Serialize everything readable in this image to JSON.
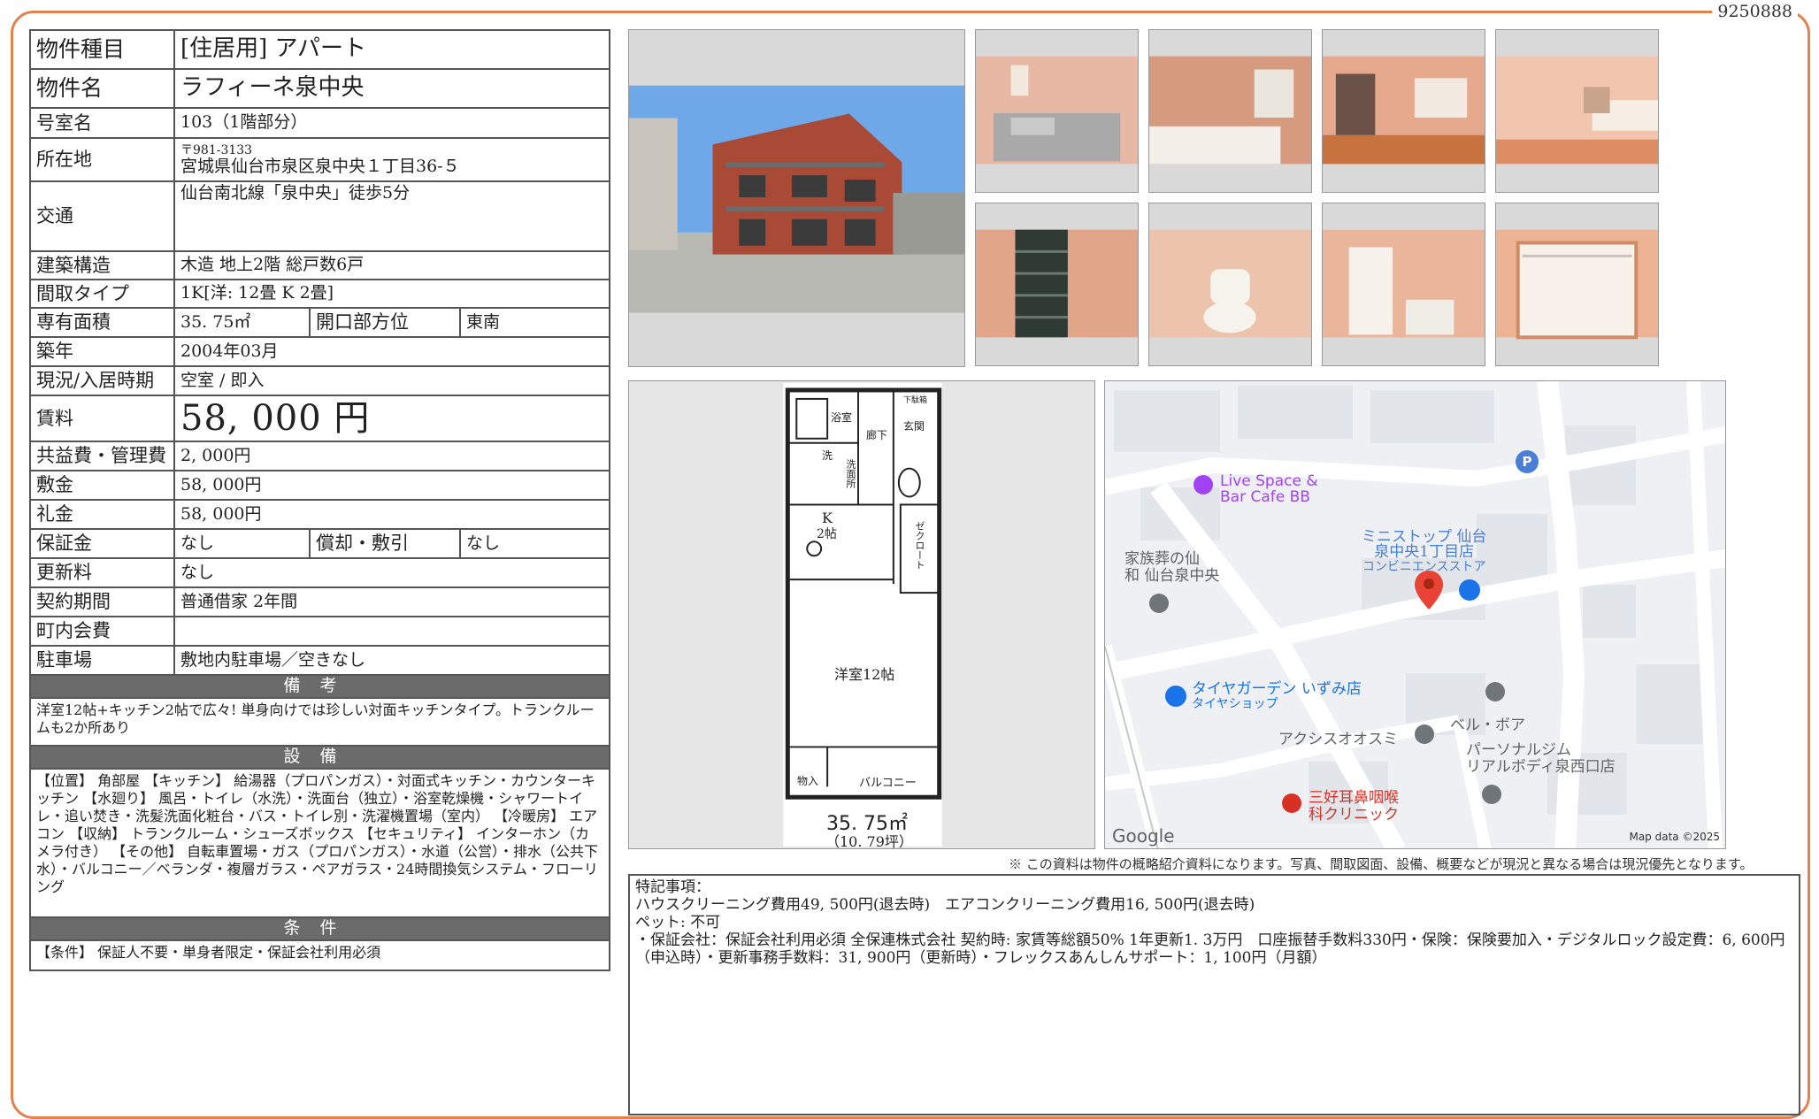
{
  "document_number": "9250888",
  "info": {
    "type": {
      "label": "物件種目",
      "value": "[住居用] アパート"
    },
    "name": {
      "label": "物件名",
      "value": "ラフィーネ泉中央"
    },
    "room": {
      "label": "号室名",
      "value": "103（1階部分）"
    },
    "address": {
      "label": "所在地",
      "zip": "〒981-3133",
      "value": "宮城県仙台市泉区泉中央１丁目36-５"
    },
    "transport": {
      "label": "交通",
      "value": "仙台南北線「泉中央」徒歩5分"
    },
    "structure": {
      "label": "建築構造",
      "value": "木造 地上2階 総戸数6戸"
    },
    "layout": {
      "label": "間取タイプ",
      "value": "1K[洋: 12畳 K 2畳]"
    },
    "area": {
      "label": "専有面積",
      "value": "35. 75㎡",
      "label2": "開口部方位",
      "value2": "東南"
    },
    "built": {
      "label": "築年",
      "value": "2004年03月"
    },
    "status": {
      "label": "現況/入居時期",
      "value": "空室 / 即入"
    },
    "rent": {
      "label": "賃料",
      "value": "58, 000 円"
    },
    "fee": {
      "label": "共益費・管理費",
      "value": "2, 000円"
    },
    "deposit": {
      "label": "敷金",
      "value": "58, 000円"
    },
    "key_money": {
      "label": "礼金",
      "value": "58, 000円"
    },
    "guarantee": {
      "label": "保証金",
      "value": "なし",
      "label2": "償却・敷引",
      "value2": "なし"
    },
    "renewal": {
      "label": "更新料",
      "value": "なし"
    },
    "contract": {
      "label": "契約期間",
      "value": "普通借家 2年間"
    },
    "neighborhood": {
      "label": "町内会費",
      "value": ""
    },
    "parking": {
      "label": "駐車場",
      "value": "敷地内駐車場／空きなし"
    }
  },
  "remarks_section": {
    "title": "備考",
    "text": "洋室12帖+キッチン2帖で広々! 単身向けでは珍しい対面キッチンタイプ。トランクルームも2か所あり"
  },
  "equipment_section": {
    "title": "設備",
    "text": "【位置】 角部屋 【キッチン】 給湯器（プロパンガス）・対面式キッチン・カウンターキッチン 【水廻り】 風呂・トイレ（水洗）・洗面台（独立）・浴室乾燥機・シャワートイレ・追い焚き・洗髪洗面化粧台・バス・トイレ別・洗濯機置場（室内） 【冷暖房】 エアコン 【収納】 トランクルーム・シューズボックス 【セキュリティ】 インターホン（カメラ付き） 【その他】 自転車置場・ガス（プロパンガス）・水道（公営）・排水（公共下水）・バルコニー／ベランダ・複層ガラス・ペアガラス・24時間換気システム・フローリング"
  },
  "conditions_section": {
    "title": "条件",
    "text": "【条件】 保証人不要・単身者限定・保証会社利用必須"
  },
  "floorplan": {
    "rooms": {
      "bath": "浴室",
      "washroom": "洗面所",
      "wash": "洗",
      "hall": "廊下",
      "entrance": "玄関",
      "shoebox": "下駄箱",
      "kitchen": "K",
      "kitchen_size": "2帖",
      "closet": "ゼクロート",
      "western": "洋室12帖",
      "storage": "物入",
      "balcony": "バルコニー"
    },
    "area": "35. 75㎡",
    "tsubo": "（10. 79坪）"
  },
  "map": {
    "labels": {
      "livespace": "Live Space &",
      "livespace2": "Bar Cafe BB",
      "funeral": "家族葬の仙",
      "funeral2": "和 仙台泉中央",
      "ministop": "ミニストップ 仙台",
      "ministop2": "泉中央1丁目店",
      "ministop3": "コンビニエンスストア",
      "tire": "タイヤガーデン いずみ店",
      "tire2": "タイヤショップ",
      "bellboa": "ベル・ボア",
      "axis": "アクシスオオスミ",
      "gym": "パーソナルジム",
      "gym2": "リアルボディ泉西口店",
      "clinic": "三好耳鼻咽喉",
      "clinic2": "科クリニック",
      "parking": "P",
      "google": "Google",
      "mapdata": "Map data ©2025"
    },
    "colors": {
      "road": "#ffffff",
      "block": "#e4e7eb",
      "poi_purple": "#a142f4",
      "poi_blue": "#1a73e8",
      "poi_red": "#d93025",
      "poi_gray": "#70757a",
      "pin": "#ea4335"
    }
  },
  "disclaimer": "※ この資料は物件の概略紹介資料になります。写真、間取図面、設備、概要などが現況と異なる場合は現況優先となります。",
  "special_notes": {
    "line1": "特記事項：",
    "line2": "ハウスクリーニング費用49, 500円(退去時)　エアコンクリーニング費用16, 500円(退去時)",
    "line3": "ペット: 不可",
    "line4": "・保証会社：保証会社利用必須 全保連株式会社 契約時: 家賃等総額50% 1年更新1. 3万円　口座振替手数料330円・保険：保険要加入・デジタルロック設定費：6, 600円（申込時）・更新事務手数料：31, 900円（更新時）・フレックスあんしんサポート：1, 100円（月額）"
  },
  "photo_icons": [
    "building-photo-icon",
    "kitchen-photo-icon",
    "bathroom-photo-icon",
    "room-window-photo-icon",
    "room-counter-photo-icon",
    "shoebox-photo-icon",
    "toilet-photo-icon",
    "washstand-photo-icon",
    "closet-photo-icon"
  ]
}
